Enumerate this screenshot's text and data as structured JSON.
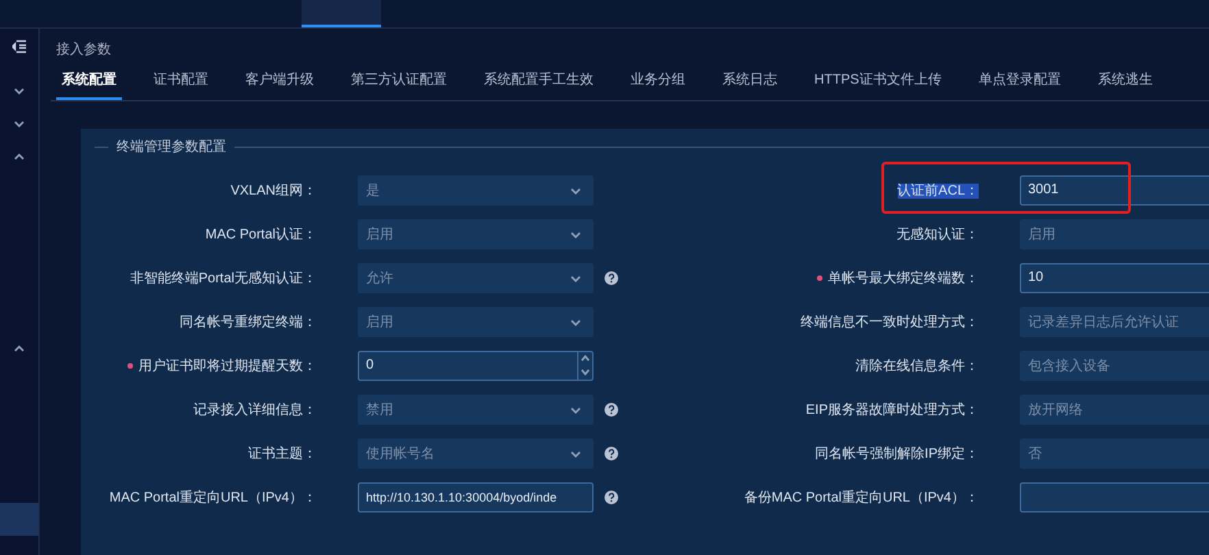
{
  "breadcrumb": "接入参数",
  "tabs": [
    {
      "label": "系统配置",
      "selected": true
    },
    {
      "label": "证书配置",
      "selected": false
    },
    {
      "label": "客户端升级",
      "selected": false
    },
    {
      "label": "第三方认证配置",
      "selected": false
    },
    {
      "label": "系统配置手工生效",
      "selected": false
    },
    {
      "label": "业务分组",
      "selected": false
    },
    {
      "label": "系统日志",
      "selected": false
    },
    {
      "label": "HTTPS证书文件上传",
      "selected": false
    },
    {
      "label": "单点登录配置",
      "selected": false
    },
    {
      "label": "系统逃生",
      "selected": false
    }
  ],
  "section_title": "终端管理参数配置",
  "left_fields": [
    {
      "label": "VXLAN组网：",
      "value": "是",
      "kind": "select",
      "required": false,
      "help": false
    },
    {
      "label": "MAC Portal认证：",
      "value": "启用",
      "kind": "select",
      "required": false,
      "help": false
    },
    {
      "label": "非智能终端Portal无感知认证：",
      "value": "允许",
      "kind": "select",
      "required": false,
      "help": true
    },
    {
      "label": "同名帐号重绑定终端：",
      "value": "启用",
      "kind": "select",
      "required": false,
      "help": false
    },
    {
      "label": "用户证书即将过期提醒天数：",
      "value": "0",
      "kind": "number",
      "required": true,
      "help": false
    },
    {
      "label": "记录接入详细信息：",
      "value": "禁用",
      "kind": "select",
      "required": false,
      "help": true
    },
    {
      "label": "证书主题：",
      "value": "使用帐号名",
      "kind": "select",
      "required": false,
      "help": true
    },
    {
      "label": "MAC Portal重定向URL（IPv4）：",
      "value": "http://10.130.1.10:30004/byod/inde",
      "kind": "input",
      "required": false,
      "help": true
    }
  ],
  "right_fields": [
    {
      "label": "认证前ACL：",
      "value": "3001",
      "kind": "input",
      "required": false,
      "highlighted": true
    },
    {
      "label": "无感知认证：",
      "value": "启用",
      "kind": "select",
      "required": false,
      "highlighted": false
    },
    {
      "label": "单帐号最大绑定终端数：",
      "value": "10",
      "kind": "input",
      "required": true,
      "highlighted": false
    },
    {
      "label": "终端信息不一致时处理方式：",
      "value": "记录差异日志后允许认证",
      "kind": "select",
      "required": false,
      "highlighted": false
    },
    {
      "label": "清除在线信息条件：",
      "value": "包含接入设备",
      "kind": "select",
      "required": false,
      "highlighted": false
    },
    {
      "label": "EIP服务器故障时处理方式：",
      "value": "放开网络",
      "kind": "select",
      "required": false,
      "highlighted": false
    },
    {
      "label": "同名帐号强制解除IP绑定：",
      "value": "否",
      "kind": "select",
      "required": false,
      "highlighted": false
    },
    {
      "label": "备份MAC Portal重定向URL（IPv4）：",
      "kind": "input",
      "required": false,
      "highlighted": false
    }
  ]
}
